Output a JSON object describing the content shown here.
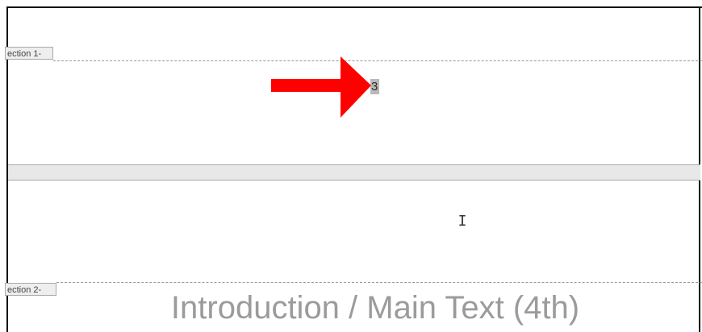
{
  "sections": [
    {
      "tab_label": "ection 1-"
    },
    {
      "tab_label": "ection 2-"
    }
  ],
  "page_number": "3",
  "document": {
    "heading": "Introduction / Main Text (4th)"
  },
  "annotation": {
    "arrow_color": "#ff0000"
  },
  "cursor": {
    "type": "ibeam-cursor",
    "glyph": "I"
  }
}
